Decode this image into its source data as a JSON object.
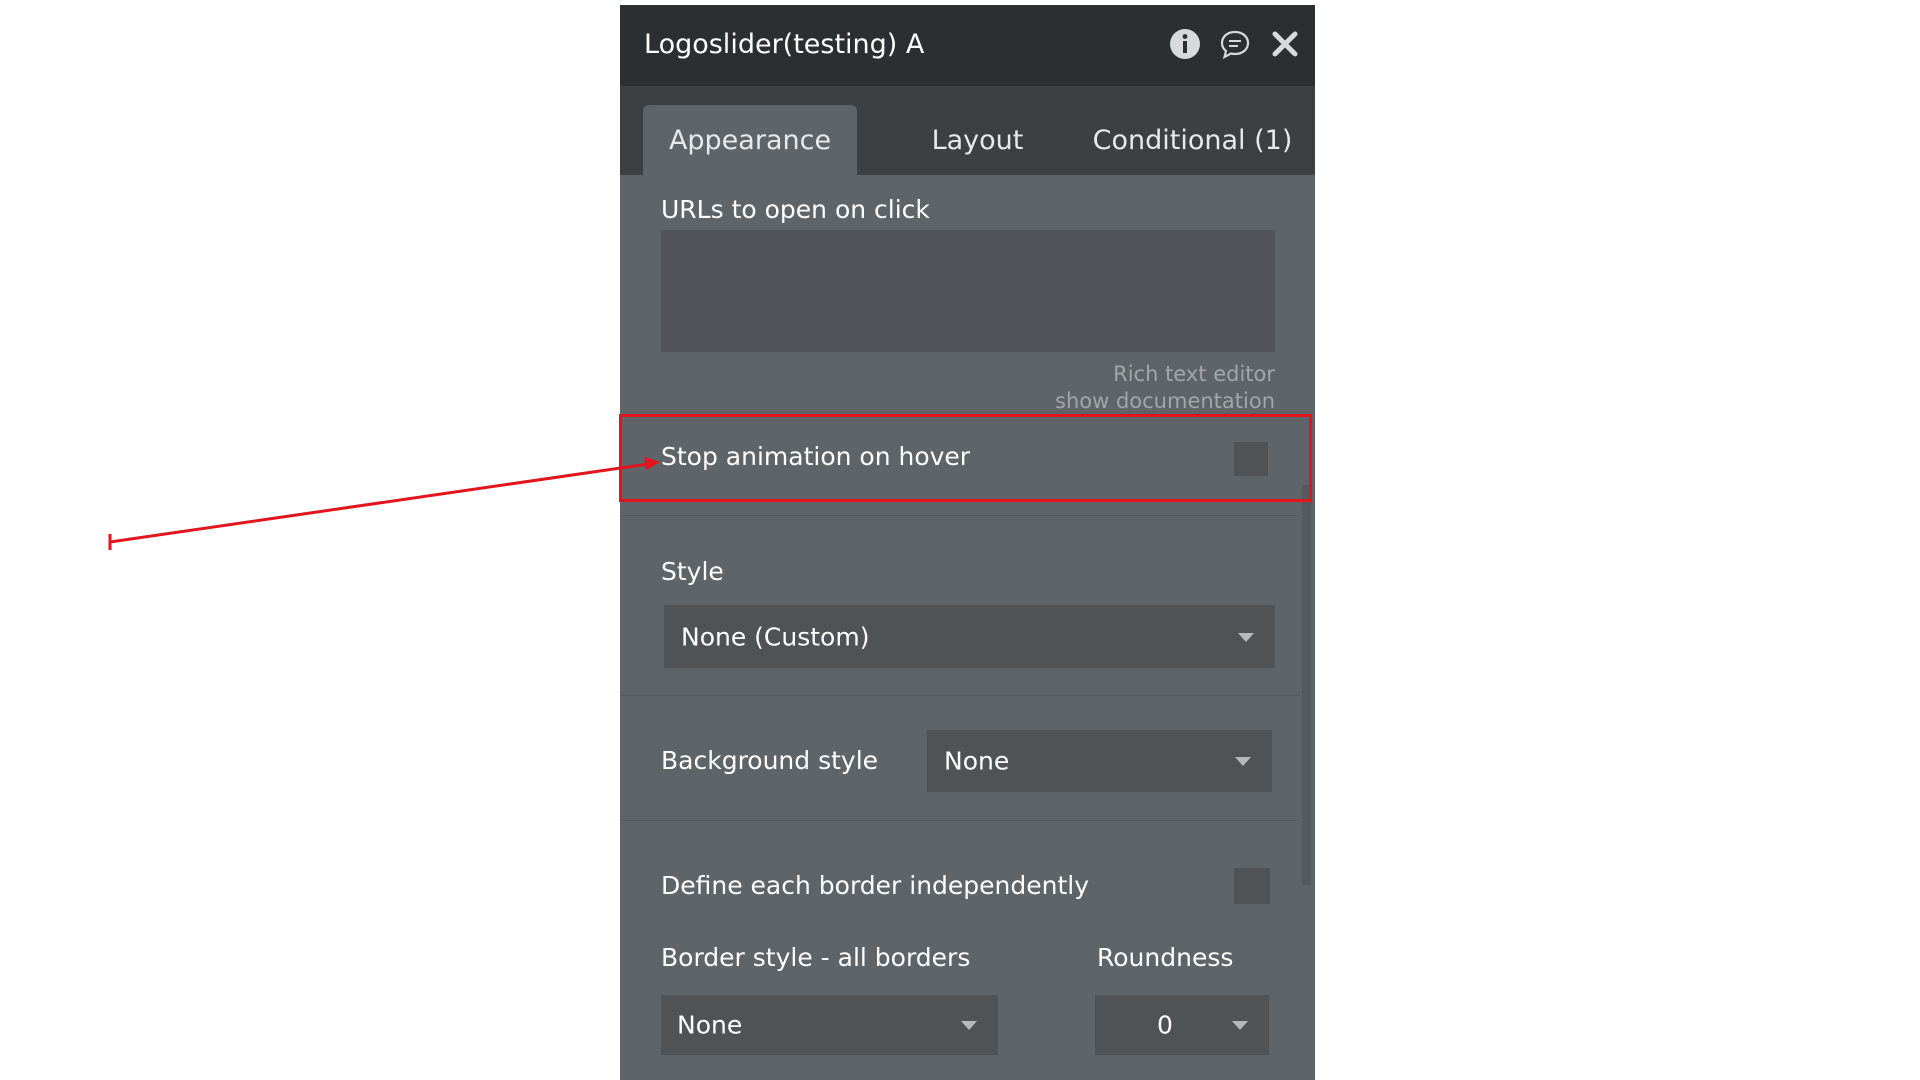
{
  "panel": {
    "title": "Logoslider(testing) A",
    "header_icons": [
      "info-icon",
      "comment-icon",
      "close-icon"
    ]
  },
  "tabs": [
    {
      "label": "Appearance",
      "active": true
    },
    {
      "label": "Layout",
      "active": false
    },
    {
      "label": "Conditional (1)",
      "active": false
    }
  ],
  "urls_field": {
    "label": "URLs to open on click",
    "value": "",
    "hint_rich_text": "Rich text editor",
    "hint_docs": "show documentation"
  },
  "stop_animation": {
    "label": "Stop animation on hover",
    "checked": false
  },
  "style": {
    "label": "Style",
    "value": "None (Custom)"
  },
  "background_style": {
    "label": "Background style",
    "value": "None"
  },
  "define_border": {
    "label": "Define each border independently",
    "checked": false
  },
  "border_style": {
    "label": "Border style - all borders",
    "value": "None"
  },
  "roundness": {
    "label": "Roundness",
    "value": "0"
  },
  "colors": {
    "panel_bg": "#5f6468",
    "header_bg": "#2b2f31",
    "tabbar_bg": "#3c4042",
    "input_bg": "#4f5356",
    "annotation": "#e3141c"
  }
}
